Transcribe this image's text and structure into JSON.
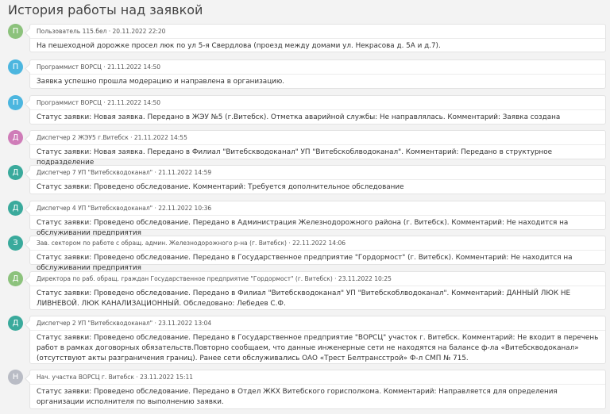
{
  "title": "История работы над заявкой",
  "colors": {
    "green": "#8cc27c",
    "blue": "#4cb6df",
    "pink": "#cf7cb8",
    "teal": "#3aaa9c",
    "gray": "#b9bcc5"
  },
  "entries": [
    {
      "initial": "П",
      "color": "green",
      "author": "Пользователь 115.бел",
      "date": "20.11.2022 22:20",
      "text": "На пешеходной дорожке просел люк по ул 5-я Свердлова (проезд между домами ул. Некрасова д. 5А и д.7)."
    },
    {
      "initial": "П",
      "color": "blue",
      "author": "Программист ВОРСЦ",
      "date": "21.11.2022 14:50",
      "text": "Заявка успешно прошла модерацию и направлена в организацию."
    },
    {
      "initial": "П",
      "color": "blue",
      "author": "Программист ВОРСЦ",
      "date": "21.11.2022 14:50",
      "text": "Статус заявки: Новая заявка. Передано в ЖЭУ №5 (г.Витебск). Отметка аварийной службы: Не направлялась. Комментарий: Заявка создана"
    },
    {
      "initial": "Д",
      "color": "pink",
      "author": "Диспетчер 2 ЖЭУ5 г.Витебск",
      "date": "21.11.2022 14:55",
      "text": "Статус заявки: Новая заявка. Передано в Филиал \"Витебскводоканал\" УП \"Витебскоблводоканал\". Комментарий: Передано в структурное подразделение"
    },
    {
      "initial": "Д",
      "color": "teal",
      "author": "Диспетчер 7 УП \"Витебскводоканал\"",
      "date": "21.11.2022 14:59",
      "text": "Статус заявки: Проведено обследование. Комментарий: Требуется дополнительное обследование"
    },
    {
      "initial": "Д",
      "color": "teal",
      "author": "Диспетчер 4 УП \"Витебскводоканал\"",
      "date": "22.11.2022 10:36",
      "text": "Статус заявки: Проведено обследование. Передано в Администрация Железнодорожного района (г. Витебск). Комментарий: Не находится на обслуживании предприятия"
    },
    {
      "initial": "З",
      "color": "teal",
      "author": "Зав. сектором по работе с обращ. админ. Железнодорожного р-на (г. Витебск)",
      "date": "22.11.2022 14:06",
      "text": "Статус заявки: Проведено обследование. Передано в Государственное предприятие \"Гордормост\" (г. Витебск). Комментарий: Не находится на обслуживании предприятия"
    },
    {
      "initial": "Д",
      "color": "green",
      "author": "Директора по раб. обращ. граждан Государственное предприятие \"Гордормост\" (г. Витебск)",
      "date": "23.11.2022 10:25",
      "text": "Статус заявки: Проведено обследование. Передано в Филиал \"Витебскводоканал\" УП \"Витебскоблводоканал\". Комментарий: ДАННЫЙ ЛЮК НЕ ЛИВНЕВОЙ. ЛЮК КАНАЛИЗАЦИОННЫЙ. Обследовано: Лебедев С.Ф."
    },
    {
      "initial": "Д",
      "color": "teal",
      "author": "Диспетчер 2 УП \"Витебскводоканал\"",
      "date": "23.11.2022 13:04",
      "text": "Статус заявки: Проведено обследование. Передано в Государственное предприятие \"ВОРСЦ\" участок г. Витебск. Комментарий: Не входит в перечень работ в рамках договорных обязательств.Повторно сообщаем, что данные инженерные сети не находятся на балансе ф-ла «Витебскводоканал» (отсутствуют акты разграничения границ). Ранее сети обслуживались ОАО «Трест Белтрансстрой» Ф-л СМП № 715."
    },
    {
      "initial": "Н",
      "color": "gray",
      "author": "Нач. участка ВОРСЦ г. Витебск",
      "date": "23.11.2022 15:11",
      "text": "Статус заявки: Проведено обследование. Передано в Отдел ЖКХ Витебского горисполкома. Комментарий: Направляется для определения организации исполнителя по выполнению заявки."
    }
  ]
}
